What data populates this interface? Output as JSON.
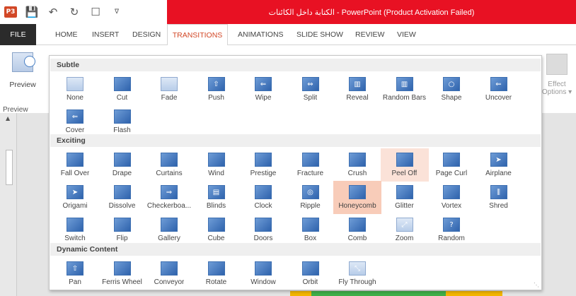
{
  "window": {
    "title": "PowerPoint (Product Activation Failed) - الكتابة داخل الكائنات",
    "app_icon": "P3"
  },
  "quick_access": {
    "icons": [
      "save-icon",
      "undo-icon",
      "redo-icon",
      "touch-mode-icon",
      "customize-qat-icon"
    ]
  },
  "tabs": [
    "FILE",
    "HOME",
    "INSERT",
    "DESIGN",
    "TRANSITIONS",
    "ANIMATIONS",
    "SLIDE SHOW",
    "REVIEW",
    "VIEW"
  ],
  "active_tab": "TRANSITIONS",
  "ribbon": {
    "preview_label": "Preview",
    "preview_group_label": "Preview",
    "effect_options_line1": "Effect",
    "effect_options_line2": "Options ▾"
  },
  "gallery": {
    "sections": [
      {
        "title": "Subtle",
        "items": [
          "None",
          "Cut",
          "Fade",
          "Push",
          "Wipe",
          "Split",
          "Reveal",
          "Random Bars",
          "Shape",
          "Uncover",
          "Cover",
          "Flash"
        ]
      },
      {
        "title": "Exciting",
        "items": [
          "Fall Over",
          "Drape",
          "Curtains",
          "Wind",
          "Prestige",
          "Fracture",
          "Crush",
          "Peel Off",
          "Page Curl",
          "Airplane",
          "Origami",
          "Dissolve",
          "Checkerboa...",
          "Blinds",
          "Clock",
          "Ripple",
          "Honeycomb",
          "Glitter",
          "Vortex",
          "Shred",
          "Switch",
          "Flip",
          "Gallery",
          "Cube",
          "Doors",
          "Box",
          "Comb",
          "Zoom",
          "Random"
        ]
      },
      {
        "title": "Dynamic Content",
        "items": [
          "Pan",
          "Ferris Wheel",
          "Conveyor",
          "Rotate",
          "Window",
          "Orbit",
          "Fly Through"
        ]
      }
    ],
    "selected_item": "Honeycomb",
    "hovered_item": "Peel Off"
  },
  "colors": {
    "title_bar": "#e81123",
    "accent": "#d24726",
    "selected_bg": "#f8ccb9",
    "hover_bg": "#fbe2d8",
    "thumbnail_blue": "#2f63ad"
  }
}
